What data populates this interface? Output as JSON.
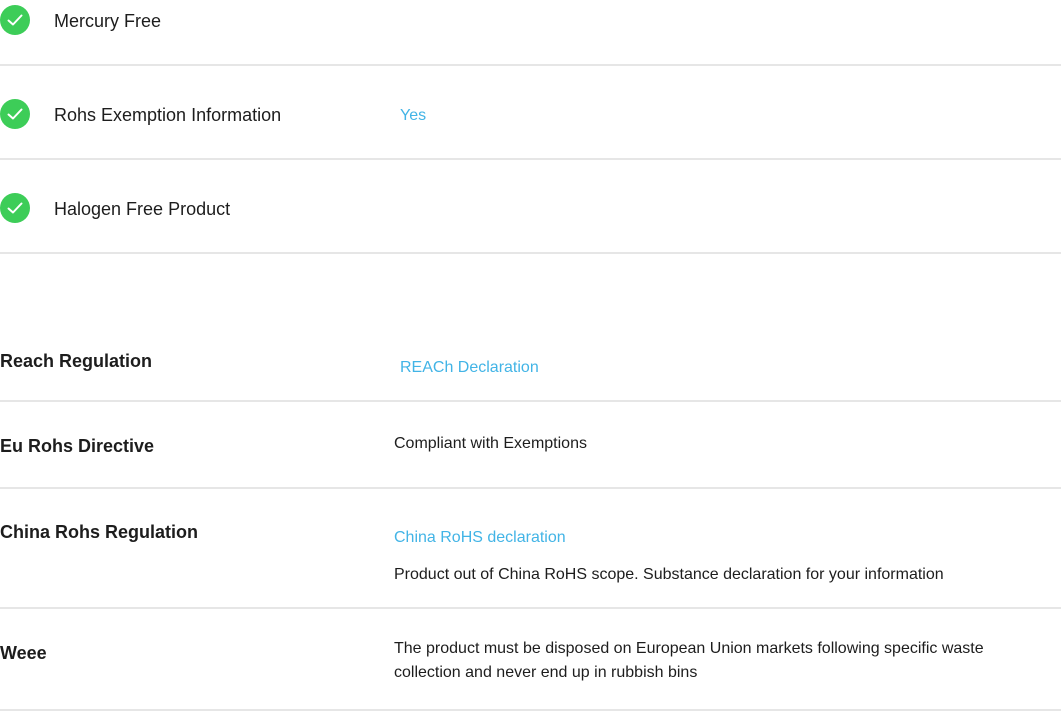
{
  "checks": [
    {
      "label": "Mercury Free",
      "value": ""
    },
    {
      "label": "Rohs Exemption Information",
      "value": "Yes"
    },
    {
      "label": "Halogen Free Product",
      "value": ""
    }
  ],
  "environment": {
    "reach": {
      "label": "Reach Regulation",
      "link": "REACh Declaration"
    },
    "eu_rohs": {
      "label": "Eu Rohs Directive",
      "value": "Compliant with Exemptions"
    },
    "china_rohs": {
      "label": "China Rohs Regulation",
      "link": "China RoHS declaration",
      "note": "Product out of China RoHS scope. Substance declaration for your information"
    },
    "weee": {
      "label": "Weee",
      "value": "The product must be disposed on European Union markets following specific waste collection and never end up in rubbish bins"
    }
  },
  "colors": {
    "check_green": "#3dcd58",
    "link_blue": "#42b4e6",
    "divider": "#e6e6e6"
  },
  "icons": {
    "check": "check-circle-icon"
  }
}
